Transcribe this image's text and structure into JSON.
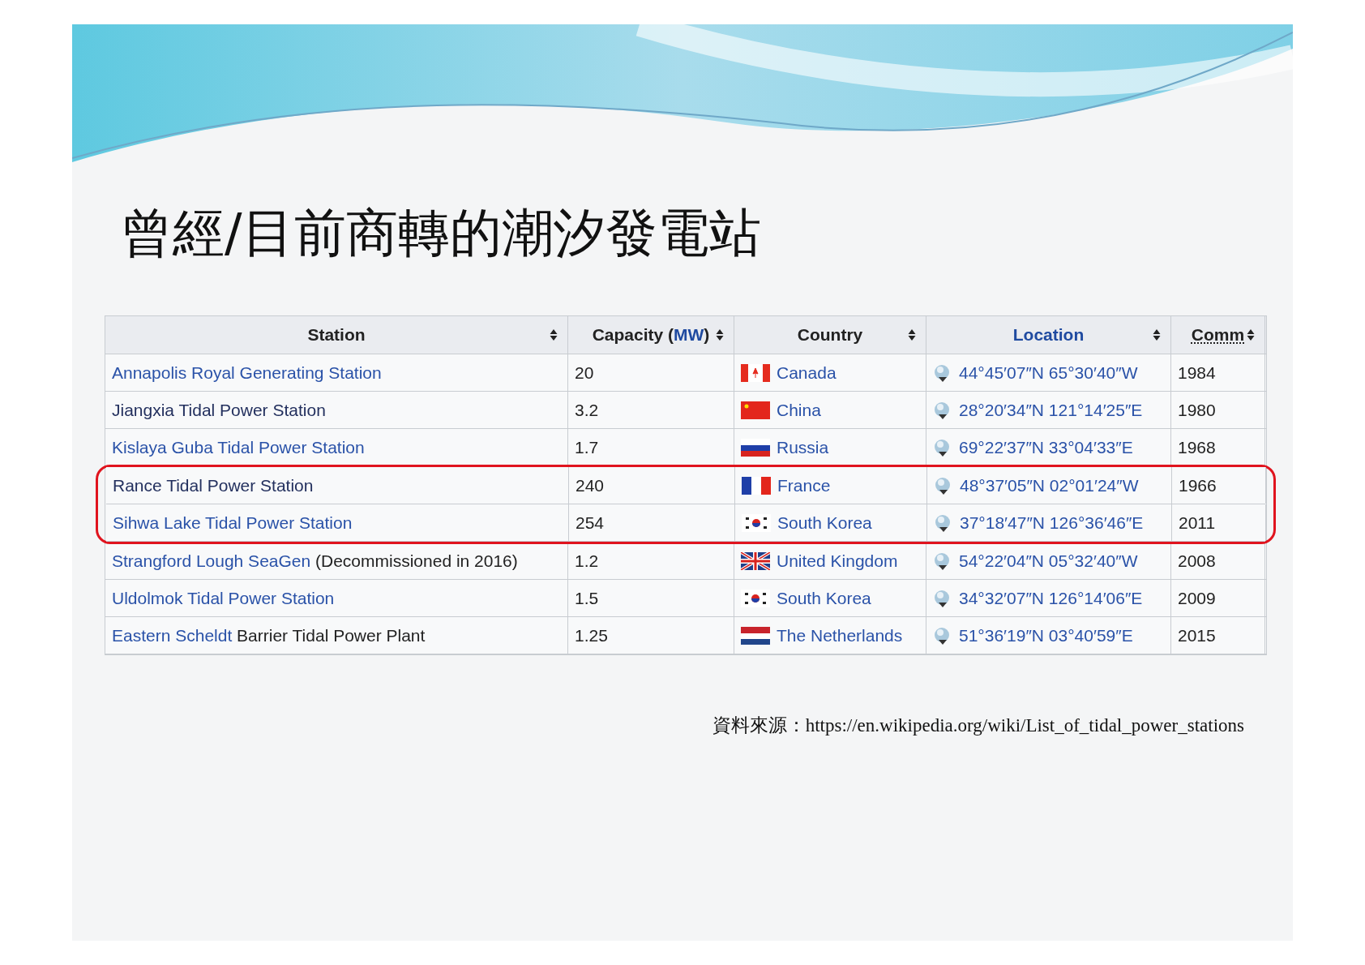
{
  "slide": {
    "title": "曾經/目前商轉的潮汐發電站",
    "source": "資料來源：https://en.wikipedia.org/wiki/List_of_tidal_power_stations"
  },
  "table": {
    "columns": [
      {
        "parts": [
          {
            "text": "Station",
            "kind": "plain"
          }
        ]
      },
      {
        "parts": [
          {
            "text": "Capacity (",
            "kind": "plain"
          },
          {
            "text": "MW",
            "kind": "link"
          },
          {
            "text": ")",
            "kind": "plain"
          }
        ]
      },
      {
        "parts": [
          {
            "text": "Country",
            "kind": "plain"
          }
        ]
      },
      {
        "parts": [
          {
            "text": "Location",
            "kind": "link"
          }
        ]
      },
      {
        "parts": [
          {
            "text": "Comm",
            "kind": "abbr"
          }
        ]
      }
    ],
    "rows": [
      {
        "station": "Annapolis Royal Generating Station",
        "visited": false,
        "capacity": "20",
        "flag": {
          "kind": "ca"
        },
        "country": "Canada",
        "location": "44°45′07″N 65°30′40″W",
        "comm": "1984",
        "highlighted": false
      },
      {
        "station": "Jiangxia Tidal Power Station",
        "visited": true,
        "capacity": "3.2",
        "flag": {
          "kind": "cn"
        },
        "country": "China",
        "location": "28°20′34″N 121°14′25″E",
        "comm": "1980",
        "highlighted": false
      },
      {
        "station": "Kislaya Guba Tidal Power Station",
        "visited": false,
        "capacity": "1.7",
        "flag": {
          "kind": "ru"
        },
        "country": "Russia",
        "location": "69°22′37″N 33°04′33″E",
        "comm": "1968",
        "highlighted": false
      },
      {
        "station": "Rance Tidal Power Station",
        "visited": true,
        "capacity": "240",
        "flag": {
          "kind": "fr"
        },
        "country": "France",
        "location": "48°37′05″N 02°01′24″W",
        "comm": "1966",
        "highlighted": true
      },
      {
        "station": "Sihwa Lake Tidal Power Station",
        "visited": false,
        "capacity": "254",
        "flag": {
          "kind": "kr"
        },
        "country": "South Korea",
        "location": "37°18′47″N 126°36′46″E",
        "comm": "2011",
        "highlighted": true
      },
      {
        "station": "Strangford Lough SeaGen",
        "note": " (Decommissioned in 2016)",
        "visited": false,
        "capacity": "1.2",
        "flag": {
          "kind": "gb"
        },
        "country": "United Kingdom",
        "location": "54°22′04″N 05°32′40″W",
        "comm": "2008",
        "highlighted": false
      },
      {
        "station": "Uldolmok Tidal Power Station",
        "visited": false,
        "capacity": "1.5",
        "flag": {
          "kind": "kr"
        },
        "country": "South Korea",
        "location": "34°32′07″N 126°14′06″E",
        "comm": "2009",
        "highlighted": false
      },
      {
        "station": "Eastern Scheldt",
        "note": " Barrier Tidal Power Plant",
        "visited": false,
        "capacity": "1.25",
        "flag": {
          "kind": "nl"
        },
        "country": "The Netherlands",
        "location": "51°36′19″N 03°40′59″E",
        "comm": "2015",
        "highlighted": false
      }
    ]
  }
}
